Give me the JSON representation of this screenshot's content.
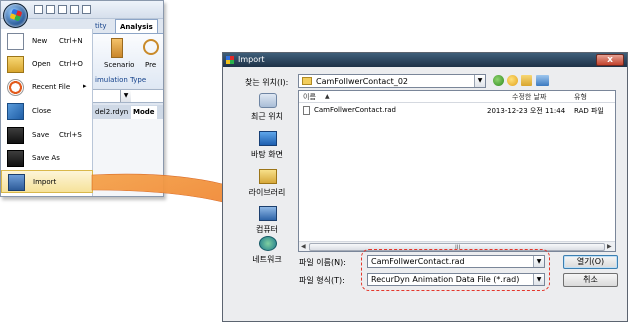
{
  "app": {
    "tabs": [
      "tity",
      "Analysis"
    ],
    "ribbon_buttons": [
      "Scenario",
      "Pre"
    ],
    "ribbon_group": "imulation Type",
    "doc_tabs": [
      "del2.rdyn",
      "Mode"
    ]
  },
  "menu": {
    "items": [
      {
        "label": "New",
        "shortcut": "Ctrl+N",
        "icon": "new-document-icon"
      },
      {
        "label": "Open",
        "shortcut": "Ctrl+O",
        "icon": "open-folder-icon"
      },
      {
        "label": "Recent File",
        "shortcut": "",
        "icon": "recent-files-icon",
        "submenu": "▸"
      },
      {
        "label": "Close",
        "shortcut": "",
        "icon": "close-document-icon"
      },
      {
        "label": "Save",
        "shortcut": "Ctrl+S",
        "icon": "save-icon"
      },
      {
        "label": "Save As",
        "shortcut": "",
        "icon": "save-as-icon"
      },
      {
        "label": "Import",
        "shortcut": "",
        "icon": "import-icon"
      }
    ]
  },
  "dialog": {
    "title": "Import",
    "close": "x",
    "look_in_label": "찾는 위치(I):",
    "look_in_value": "CamFollwerContact_02",
    "places": [
      "최근 위치",
      "바탕 화면",
      "라이브러리",
      "컴퓨터",
      "네트워크"
    ],
    "columns": [
      "이름",
      "수정한 날짜",
      "유형"
    ],
    "sort_indicator": "▲",
    "files": [
      {
        "name": "CamFollwerContact.rad",
        "modified": "2013-12-23 오전 11:44",
        "type": "RAD 파일"
      }
    ],
    "scroll_grip": "III",
    "filename_label": "파일 이름(N):",
    "filename_value": "CamFollwerContact.rad",
    "filetype_label": "파일 형식(T):",
    "filetype_value": "RecurDyn Animation Data File (*.rad)",
    "open_button": "열기(O)",
    "cancel_button": "취소"
  },
  "colors": {
    "highlight": "#e4362a",
    "arrow": "#f07a2a",
    "title_bar": "#2a4058"
  }
}
